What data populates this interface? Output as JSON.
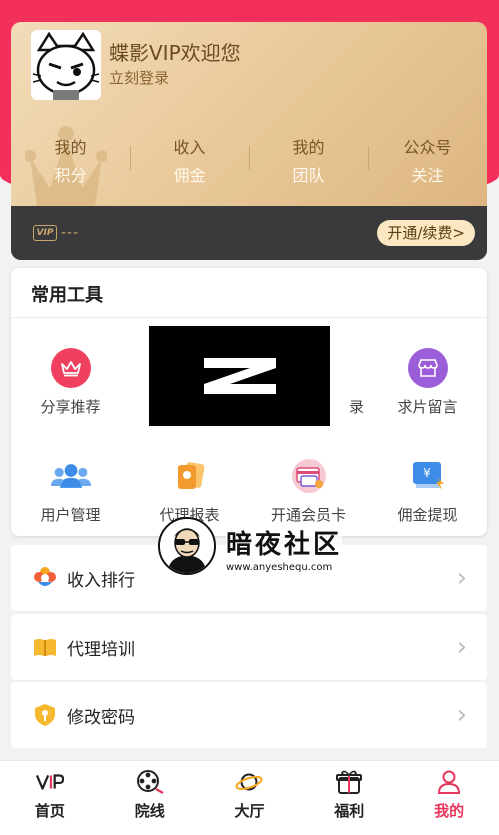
{
  "header": {
    "welcome_text": "蝶影VIP欢迎您",
    "login_link": "立刻登录"
  },
  "stats": [
    {
      "top": "我的",
      "bottom": "积分"
    },
    {
      "top": "收入",
      "bottom": "佣金"
    },
    {
      "top": "我的",
      "bottom": "团队"
    },
    {
      "top": "公众号",
      "bottom": "关注"
    }
  ],
  "vip_bar": {
    "badge": "VIP",
    "status": "---",
    "renew_button": "开通/续费>"
  },
  "tools": {
    "title": "常用工具",
    "items": [
      {
        "label": "分享推荐",
        "icon": "crown-icon"
      },
      {
        "label": "录",
        "icon": "record-icon"
      },
      {
        "label": "求片留言",
        "icon": "store-icon"
      },
      {
        "label": "用户管理",
        "icon": "users-icon"
      },
      {
        "label": "代理报表",
        "icon": "report-icon"
      },
      {
        "label": "开通会员卡",
        "icon": "card-icon"
      },
      {
        "label": "佣金提现",
        "icon": "withdraw-icon"
      }
    ]
  },
  "menu_list": [
    {
      "label": "收入排行",
      "icon": "flower-icon"
    },
    {
      "label": "代理培训",
      "icon": "book-icon"
    },
    {
      "label": "修改密码",
      "icon": "shield-icon"
    }
  ],
  "watermark": {
    "title": "暗夜社区",
    "url": "www.anyeshequ.com"
  },
  "overlay_glyph": "Z",
  "bottom_nav": [
    {
      "label": "首页",
      "icon": "vip-icon",
      "active": false
    },
    {
      "label": "院线",
      "icon": "film-reel-icon",
      "active": false
    },
    {
      "label": "大厅",
      "icon": "planet-icon",
      "active": false
    },
    {
      "label": "福利",
      "icon": "gift-icon",
      "active": false
    },
    {
      "label": "我的",
      "icon": "user-icon",
      "active": true
    }
  ],
  "colors": {
    "primary_red": "#f2305b",
    "gold_card": "#e9c99a",
    "dark_bar": "#3a3a3c",
    "active_nav": "#e8365d"
  }
}
